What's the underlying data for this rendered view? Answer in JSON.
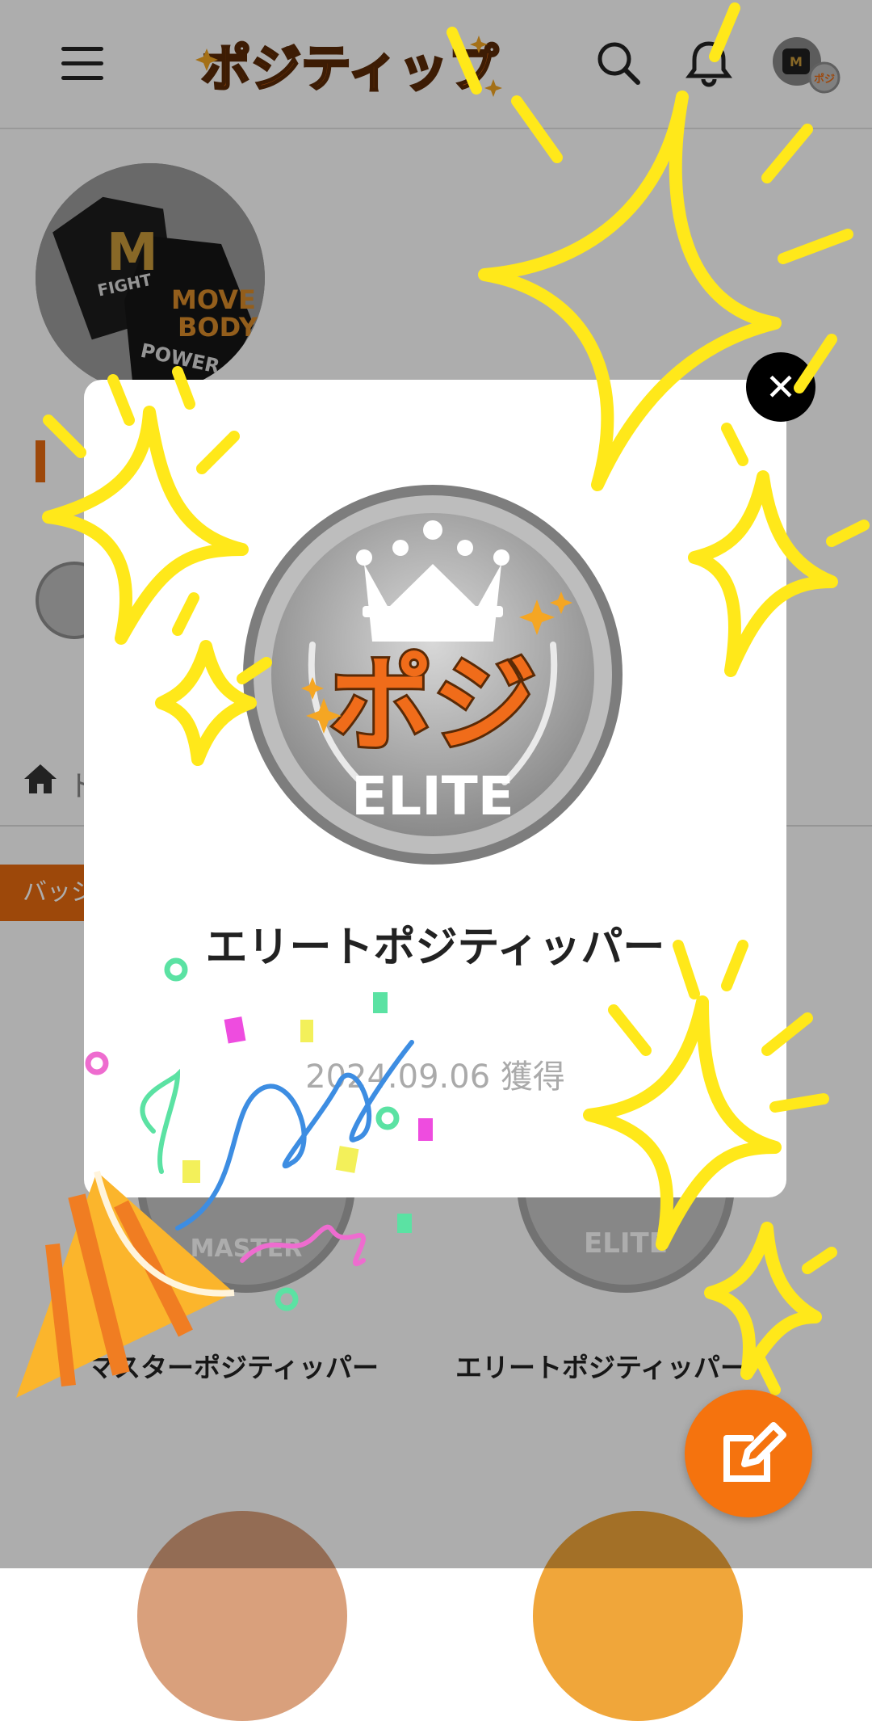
{
  "header": {
    "app_name": "ポジティップ",
    "menu_icon": "hamburger-menu-icon",
    "search_icon": "search-icon",
    "bell_icon": "bell-icon"
  },
  "profile": {
    "avatar_text_1": "M",
    "avatar_text_2": "FIGHT",
    "avatar_text_3": "MOVE",
    "avatar_text_4": "BODY",
    "avatar_text_5": "POWER"
  },
  "breadcrumb": {
    "home_icon": "home-icon",
    "first": "ト"
  },
  "tabs": {
    "active_label": "バッジ"
  },
  "badges_grid": [
    {
      "label": "マスターポジティッパー",
      "emblem": "MASTER"
    },
    {
      "label": "エリートポジティッパー",
      "emblem": "ELITE"
    }
  ],
  "modal": {
    "badge_text": "ポジ",
    "badge_tier": "ELITE",
    "title": "エリートポジティッパー",
    "date": "2024.09.06 獲得",
    "close_label": "✕"
  },
  "fab": {
    "icon": "edit-icon"
  },
  "colors": {
    "accent": "#f5730e",
    "silver": "#a8a8a8",
    "sparkle": "#ffe81a"
  }
}
